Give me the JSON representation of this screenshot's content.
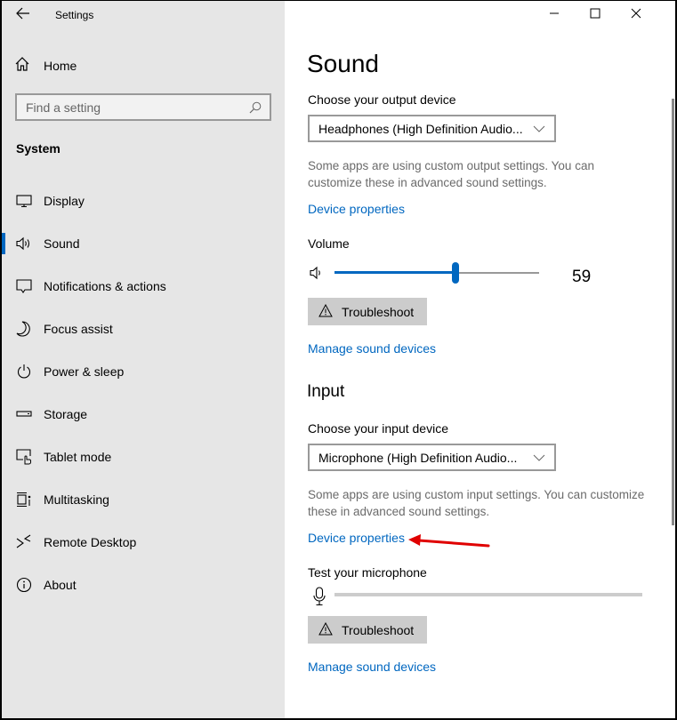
{
  "window": {
    "title": "Settings",
    "controls": {
      "minimize": "minimize-icon",
      "maximize": "maximize-icon",
      "close": "close-icon"
    }
  },
  "sidebar": {
    "back_icon": "back-arrow-icon",
    "home": {
      "label": "Home",
      "icon": "home-icon"
    },
    "search": {
      "placeholder": "Find a setting",
      "value": "",
      "icon": "search-icon"
    },
    "section": "System",
    "items": [
      {
        "label": "Display",
        "icon": "display-icon",
        "active": false
      },
      {
        "label": "Sound",
        "icon": "speaker-icon",
        "active": true
      },
      {
        "label": "Notifications & actions",
        "icon": "notification-icon",
        "active": false
      },
      {
        "label": "Focus assist",
        "icon": "moon-icon",
        "active": false
      },
      {
        "label": "Power & sleep",
        "icon": "power-icon",
        "active": false
      },
      {
        "label": "Storage",
        "icon": "storage-icon",
        "active": false
      },
      {
        "label": "Tablet mode",
        "icon": "tablet-mode-icon",
        "active": false
      },
      {
        "label": "Multitasking",
        "icon": "multitasking-icon",
        "active": false
      },
      {
        "label": "Remote Desktop",
        "icon": "remote-desktop-icon",
        "active": false
      },
      {
        "label": "About",
        "icon": "info-icon",
        "active": false
      }
    ],
    "accent_color": "#0067c0"
  },
  "main": {
    "title": "Sound",
    "output": {
      "label": "Choose your output device",
      "device": "Headphones (High Definition Audio...",
      "help": "Some apps are using custom output settings. You can customize these in advanced sound settings.",
      "device_properties_link": "Device properties",
      "volume_label": "Volume",
      "volume_value": 59,
      "volume_display": "59",
      "troubleshoot_label": "Troubleshoot",
      "manage_link": "Manage sound devices"
    },
    "input": {
      "heading": "Input",
      "label": "Choose your input device",
      "device": "Microphone (High Definition Audio...",
      "help": "Some apps are using custom input settings. You can customize these in advanced sound settings.",
      "device_properties_link": "Device properties",
      "test_label": "Test your microphone",
      "mic_level": 0,
      "troubleshoot_label": "Troubleshoot",
      "manage_link": "Manage sound devices"
    },
    "link_color": "#0067c0",
    "annotation": {
      "type": "red-arrow",
      "points_to": "input-device-properties-link",
      "color": "#e00000"
    }
  }
}
